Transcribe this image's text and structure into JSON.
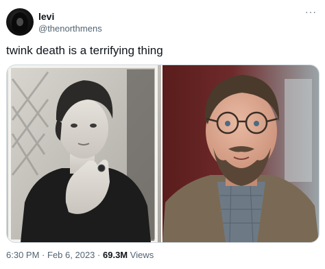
{
  "author": {
    "display_name": "levi",
    "handle": "@thenorthmens"
  },
  "more_menu": "···",
  "tweet": {
    "text": "twink death is a terrifying thing"
  },
  "media": [
    {
      "description": "young-actor-black-and-white-photo",
      "icon": "photo-icon"
    },
    {
      "description": "older-actor-color-film-still",
      "icon": "photo-icon"
    }
  ],
  "meta": {
    "time": "6:30 PM",
    "separator": "·",
    "date": "Feb 6, 2023",
    "views_count": "69.3M",
    "views_label": "Views"
  },
  "colors": {
    "text_primary": "#0f1419",
    "text_secondary": "#536471",
    "border": "#cfd9de"
  }
}
